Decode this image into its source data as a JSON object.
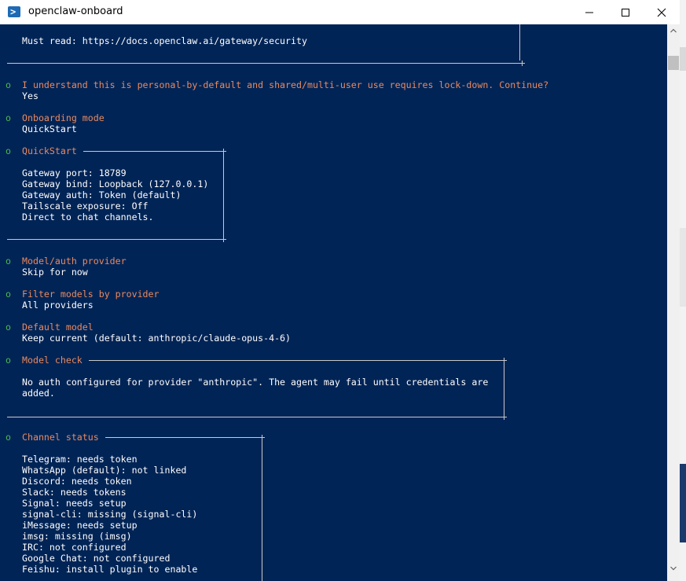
{
  "window": {
    "title": "openclaw-onboard",
    "icon": "powershell-icon",
    "controls": [
      "minimize-icon",
      "maximize-icon",
      "close-icon"
    ]
  },
  "console": {
    "security": {
      "must_read": "Must read: https://docs.openclaw.ai/gateway/security"
    },
    "confirm": {
      "prompt": "I understand this is personal-by-default and shared/multi-user use requires lock-down. Continue?",
      "answer": "Yes"
    },
    "onboarding_mode": {
      "label": "Onboarding mode",
      "value": "QuickStart"
    },
    "quickstart": {
      "title": "QuickStart",
      "lines": [
        "Gateway port: 18789",
        "Gateway bind: Loopback (127.0.0.1)",
        "Gateway auth: Token (default)",
        "Tailscale exposure: Off",
        "Direct to chat channels."
      ]
    },
    "auth_provider": {
      "label": "Model/auth provider",
      "value": "Skip for now"
    },
    "filter_models": {
      "label": "Filter models by provider",
      "value": "All providers"
    },
    "default_model": {
      "label": "Default model",
      "value": "Keep current (default: anthropic/claude-opus-4-6)"
    },
    "model_check": {
      "title": "Model check",
      "lines": [
        "No auth configured for provider \"anthropic\". The agent may fail until credentials are",
        "added."
      ]
    },
    "channel_status": {
      "title": "Channel status",
      "lines": [
        "Telegram: needs token",
        "WhatsApp (default): not linked",
        "Discord: needs token",
        "Slack: needs tokens",
        "Signal: needs setup",
        "signal-cli: missing (signal-cli)",
        "iMessage: needs setup",
        "imsg: missing (imsg)",
        "IRC: not configured",
        "Google Chat: not configured",
        "Feishu: install plugin to enable"
      ]
    }
  },
  "colors": {
    "console_bg": "#012456",
    "text": "#ffffff",
    "label": "#e98a5f",
    "step_marker": "#4cb84c",
    "border": "#c9c9c9"
  }
}
